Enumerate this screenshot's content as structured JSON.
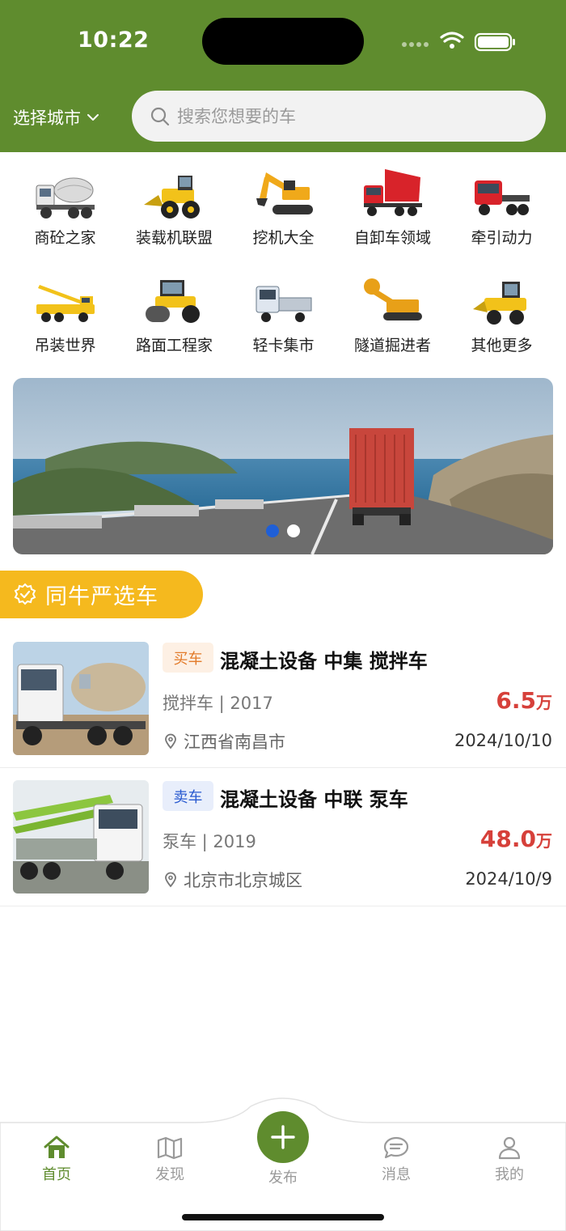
{
  "status_bar": {
    "time": "10:22"
  },
  "header": {
    "city_label": "选择城市",
    "search_placeholder": "搜索您想要的车",
    "bg_color": "#5f8c2e"
  },
  "categories": [
    {
      "label": "商砼之家",
      "icon": "concrete-mixer-truck-icon"
    },
    {
      "label": "装载机联盟",
      "icon": "wheel-loader-icon"
    },
    {
      "label": "挖机大全",
      "icon": "excavator-icon"
    },
    {
      "label": "自卸车领域",
      "icon": "dump-truck-icon"
    },
    {
      "label": "牵引动力",
      "icon": "tractor-truck-icon"
    },
    {
      "label": "吊装世界",
      "icon": "crane-truck-icon"
    },
    {
      "label": "路面工程家",
      "icon": "road-roller-icon"
    },
    {
      "label": "轻卡集市",
      "icon": "light-truck-icon"
    },
    {
      "label": "隧道掘进者",
      "icon": "tunnel-boring-machine-icon"
    },
    {
      "label": "其他更多",
      "icon": "more-machinery-icon"
    }
  ],
  "banner": {
    "slide_count": 2,
    "active_slide": 1
  },
  "section": {
    "title": "同牛严选车",
    "color": "#f5b91e"
  },
  "listings": [
    {
      "tag": "买车",
      "title": "混凝土设备 中集 搅拌车",
      "subtitle": "搅拌车 | 2017",
      "price": "6.5",
      "price_unit": "万",
      "location": "江西省南昌市",
      "date": "2024/10/10"
    },
    {
      "tag": "卖车",
      "title": "混凝土设备 中联 泵车",
      "subtitle": "泵车 | 2019",
      "price": "48.0",
      "price_unit": "万",
      "location": "北京市北京城区",
      "date": "2024/10/9"
    }
  ],
  "tabbar": {
    "items": [
      {
        "label": "首页",
        "icon": "home-icon",
        "active": true
      },
      {
        "label": "发现",
        "icon": "map-icon",
        "active": false
      },
      {
        "label": "发布",
        "icon": "plus-icon",
        "active": false
      },
      {
        "label": "消息",
        "icon": "chat-icon",
        "active": false
      },
      {
        "label": "我的",
        "icon": "user-icon",
        "active": false
      }
    ],
    "accent_color": "#5f8c2e"
  }
}
